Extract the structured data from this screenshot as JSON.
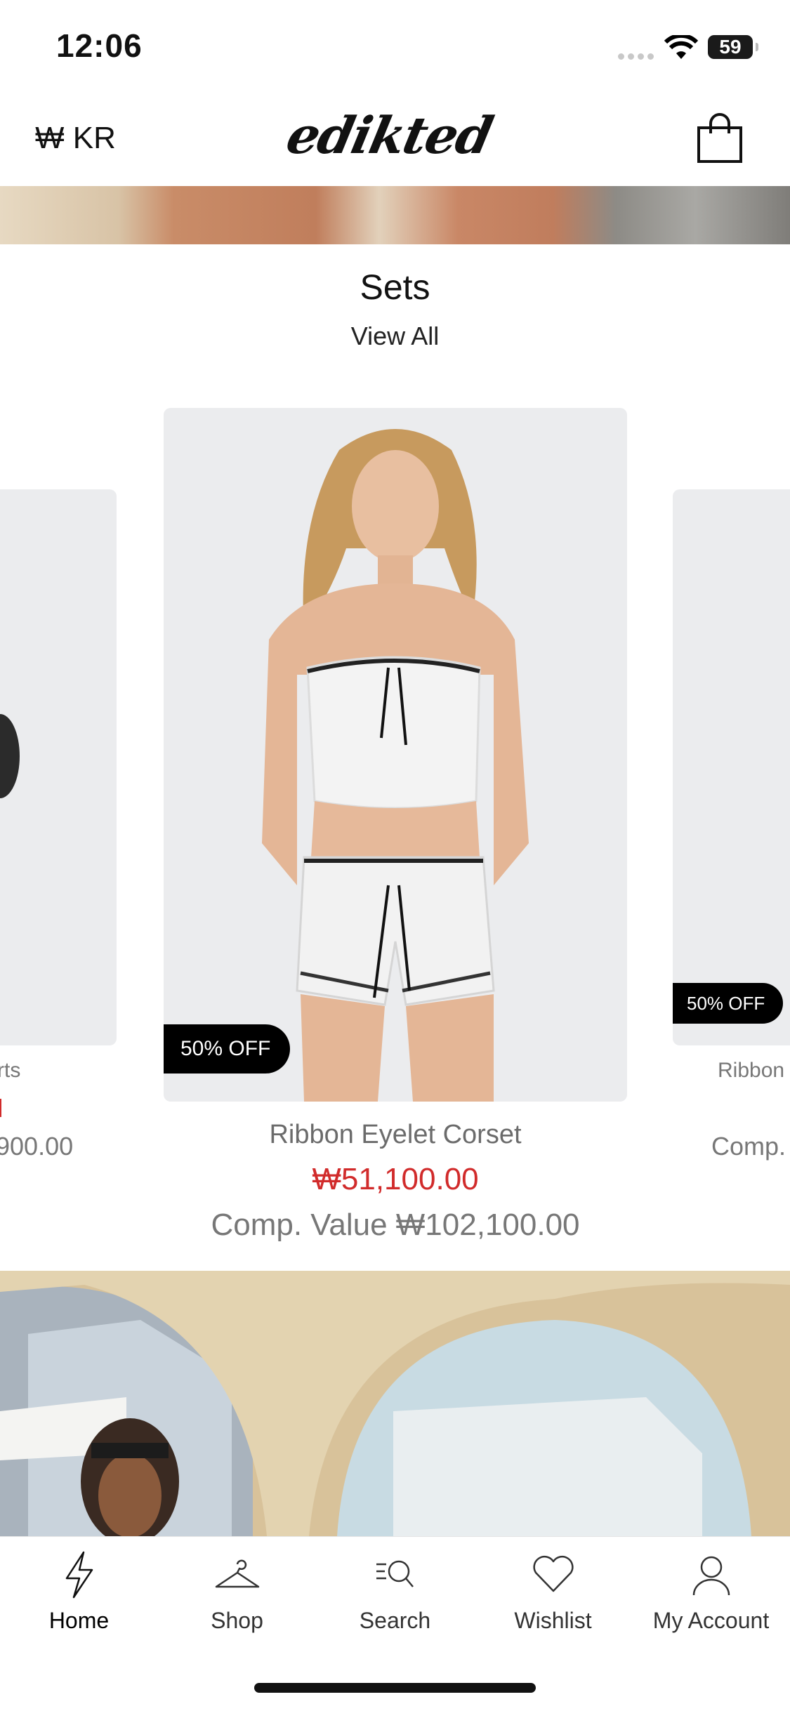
{
  "status_bar": {
    "time": "12:06",
    "battery": "59"
  },
  "header": {
    "currency": "₩ KR",
    "logo": "edikted"
  },
  "section": {
    "title": "Sets",
    "view_all": "View All"
  },
  "products": {
    "main": {
      "badge": "50% OFF",
      "name": "Ribbon Eyelet Corset",
      "price": "₩51,100.00",
      "comp_value": "Comp. Value ₩102,100.00"
    },
    "left": {
      "name_fragment": "rts",
      "comp_fragment": "900.00"
    },
    "right": {
      "badge": "50% OFF",
      "name_fragment": "Ribbon",
      "comp_fragment": "Comp."
    }
  },
  "tab_bar": {
    "items": [
      {
        "label": "Home",
        "icon": "lightning-icon",
        "active": true
      },
      {
        "label": "Shop",
        "icon": "hanger-icon",
        "active": false
      },
      {
        "label": "Search",
        "icon": "search-icon",
        "active": false
      },
      {
        "label": "Wishlist",
        "icon": "heart-icon",
        "active": false
      },
      {
        "label": "My Account",
        "icon": "account-icon",
        "active": false
      }
    ]
  },
  "colors": {
    "sale_red": "#d12b2b",
    "badge_bg": "#000000",
    "card_bg": "#ebecee"
  }
}
